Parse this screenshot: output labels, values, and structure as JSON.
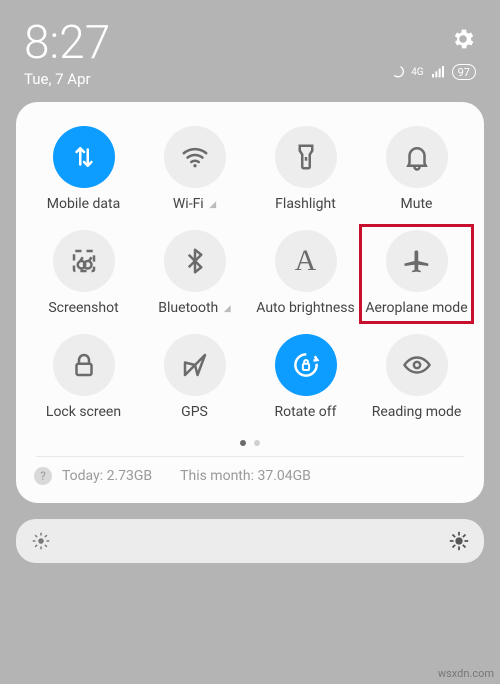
{
  "status": {
    "time": "8:27",
    "date": "Tue, 7 Apr",
    "network_label": "4G",
    "battery": "97"
  },
  "tiles": [
    {
      "id": "mobile-data",
      "label": "Mobile data",
      "icon": "data-arrows",
      "active": true,
      "highlighted": false
    },
    {
      "id": "wifi",
      "label": "Wi-Fi",
      "icon": "wifi",
      "active": false,
      "highlighted": false,
      "expandable": true
    },
    {
      "id": "flashlight",
      "label": "Flashlight",
      "icon": "flashlight",
      "active": false,
      "highlighted": false
    },
    {
      "id": "mute",
      "label": "Mute",
      "icon": "bell",
      "active": false,
      "highlighted": false
    },
    {
      "id": "screenshot",
      "label": "Screenshot",
      "icon": "screenshot",
      "active": false,
      "highlighted": false
    },
    {
      "id": "bluetooth",
      "label": "Bluetooth",
      "icon": "bluetooth",
      "active": false,
      "highlighted": false,
      "expandable": true
    },
    {
      "id": "auto-brightness",
      "label": "Auto brightness",
      "icon": "letter-a",
      "active": false,
      "highlighted": false
    },
    {
      "id": "aeroplane-mode",
      "label": "Aeroplane mode",
      "icon": "airplane",
      "active": false,
      "highlighted": true
    },
    {
      "id": "lock-screen",
      "label": "Lock screen",
      "icon": "lock",
      "active": false,
      "highlighted": false
    },
    {
      "id": "gps",
      "label": "GPS",
      "icon": "location",
      "active": false,
      "highlighted": false
    },
    {
      "id": "rotate-off",
      "label": "Rotate off",
      "icon": "rotate-lock",
      "active": true,
      "highlighted": false
    },
    {
      "id": "reading-mode",
      "label": "Reading mode",
      "icon": "eye",
      "active": false,
      "highlighted": false
    }
  ],
  "pager": {
    "current": 0,
    "total": 2
  },
  "datause": {
    "today_label": "Today:",
    "today_value": "2.73GB",
    "month_label": "This month:",
    "month_value": "37.04GB"
  },
  "watermark": "wsxdn.com"
}
